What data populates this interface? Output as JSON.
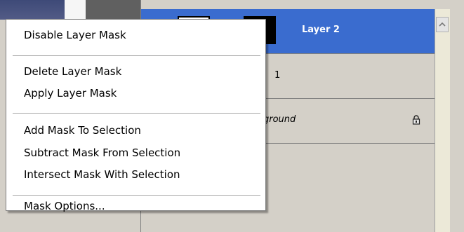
{
  "layers": {
    "rows": [
      {
        "name": "Layer 2",
        "selected": true
      },
      {
        "name": "1",
        "selected": false
      },
      {
        "name": "ground",
        "selected": false,
        "locked": true
      }
    ]
  },
  "context_menu": {
    "items": [
      {
        "label": "Disable Layer Mask"
      },
      {
        "label": "Delete Layer Mask"
      },
      {
        "label": "Apply Layer Mask"
      },
      {
        "label": "Add Mask To Selection"
      },
      {
        "label": "Subtract Mask From Selection"
      },
      {
        "label": "Intersect Mask With Selection"
      },
      {
        "label": "Mask Options..."
      }
    ]
  },
  "colors": {
    "selection_blue": "#3a6ccf",
    "menu_bg": "#ffffff",
    "panel_bg": "#d4d0c8"
  }
}
